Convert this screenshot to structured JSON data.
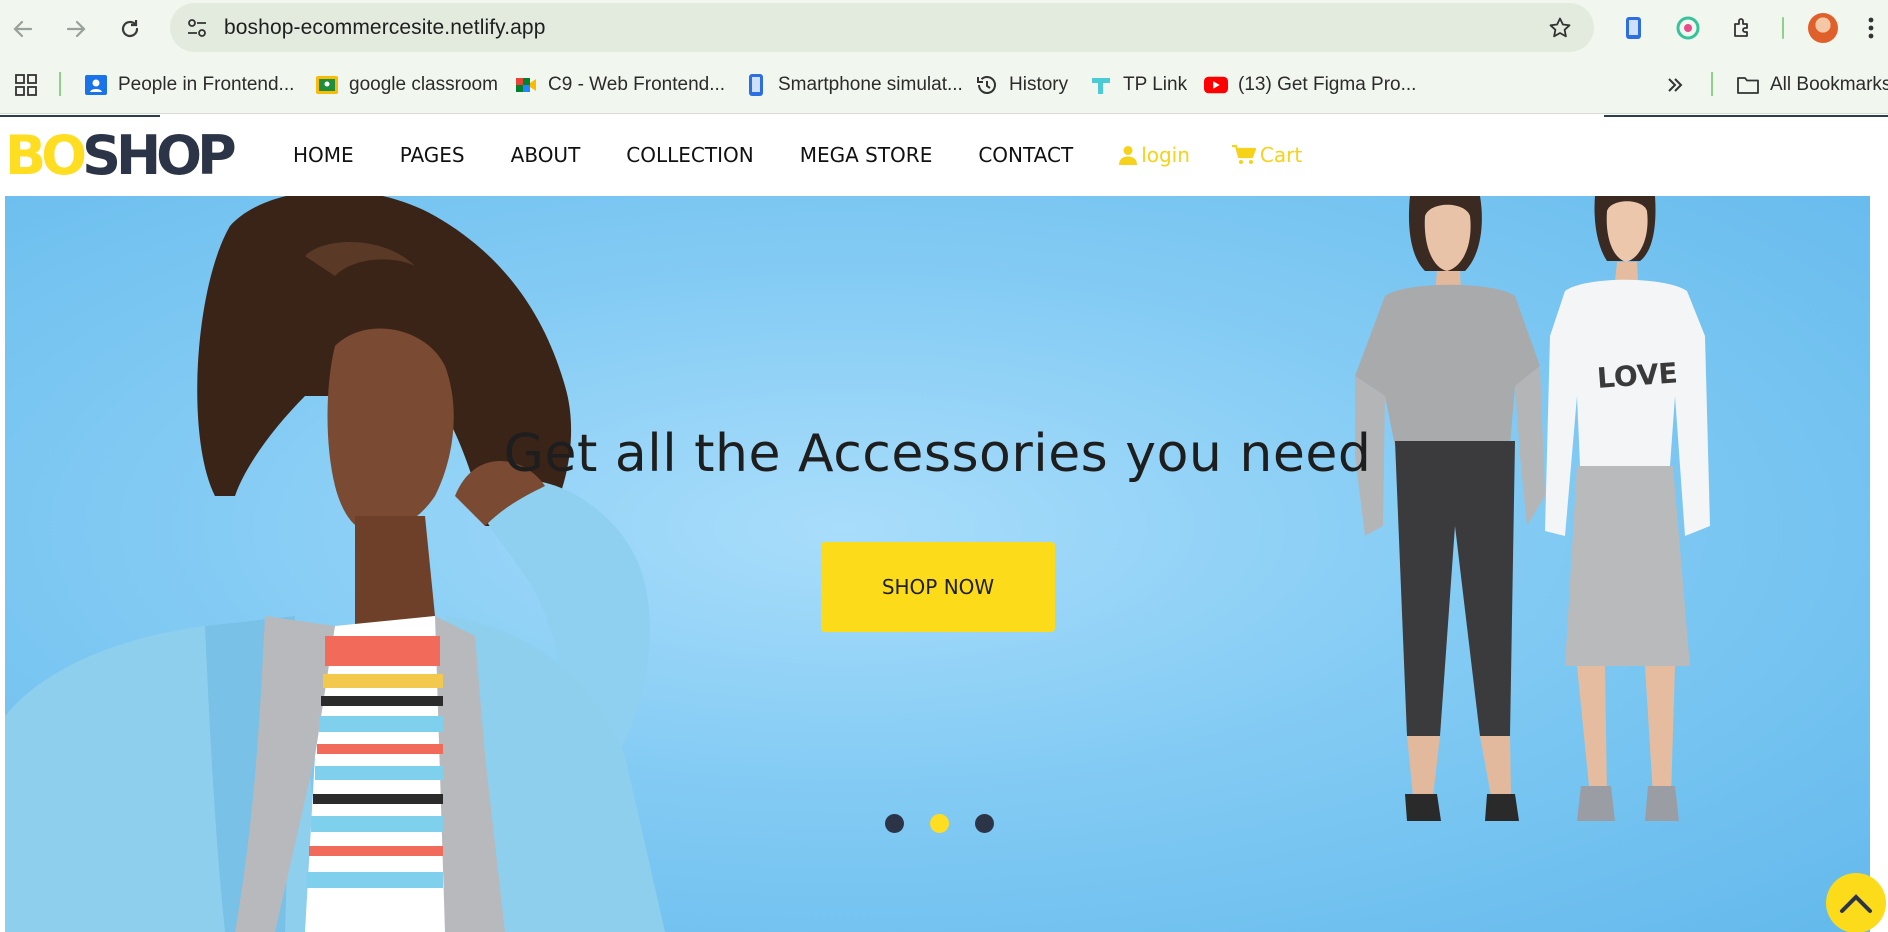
{
  "browser": {
    "url": "boshop-ecommercesite.netlify.app",
    "bookmarks": [
      {
        "label": "People in Frontend...",
        "icon": "people-icon"
      },
      {
        "label": "google classroom",
        "icon": "classroom-icon"
      },
      {
        "label": "C9 - Web Frontend...",
        "icon": "meet-icon"
      },
      {
        "label": "Smartphone simulat...",
        "icon": "smartphone-icon"
      },
      {
        "label": "History",
        "icon": "history-icon"
      },
      {
        "label": "TP Link",
        "icon": "tplink-icon"
      },
      {
        "label": "(13) Get Figma Pro...",
        "icon": "youtube-icon"
      }
    ],
    "all_bookmarks_label": "All Bookmarks"
  },
  "site": {
    "logo_part1": "BO",
    "logo_part2": "SHOP",
    "nav": [
      "HOME",
      "PAGES",
      "ABOUT",
      "COLLECTION",
      "MEGA STORE",
      "CONTACT"
    ],
    "login_label": "login",
    "cart_label": "Cart",
    "accent_color": "#ffde21",
    "dark_color": "#2c3548"
  },
  "hero": {
    "title": "Get all the Accessories you need",
    "button_label": "SHOP NOW",
    "slides": 3,
    "active_slide": 2,
    "shirt_text": "LOVE"
  }
}
